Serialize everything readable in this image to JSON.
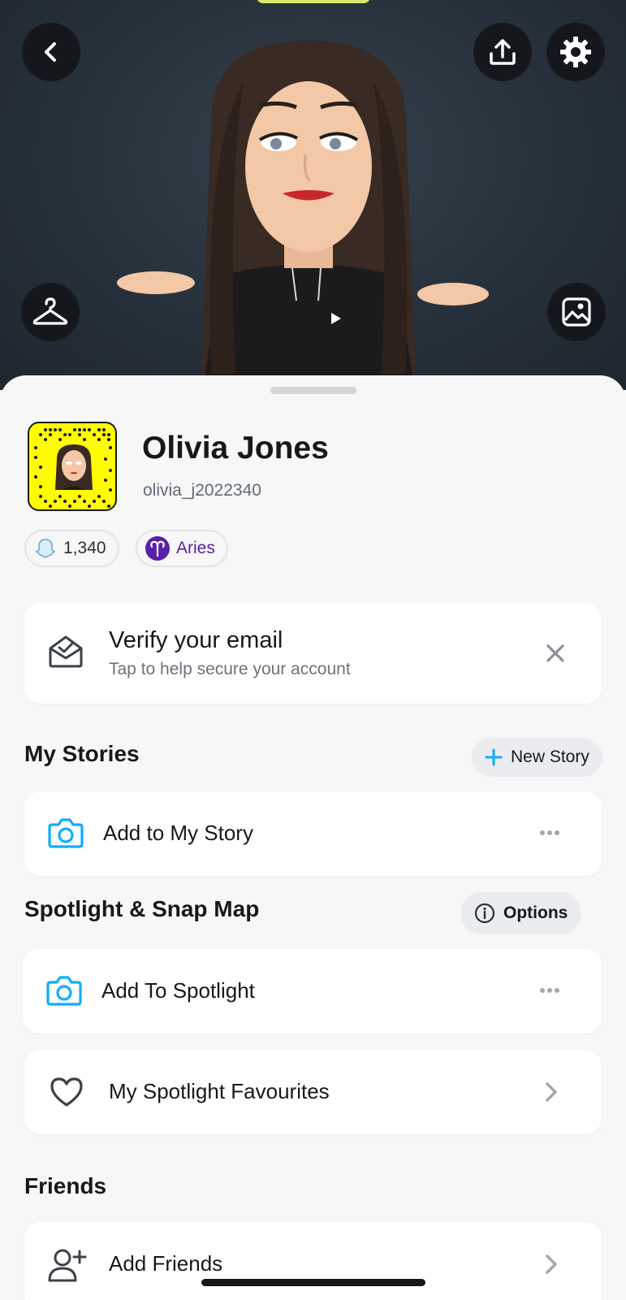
{
  "profile": {
    "display_name": "Olivia Jones",
    "username": "olivia_j2022340",
    "snap_score": "1,340",
    "zodiac": "Aries"
  },
  "header_buttons": {
    "back": "chevron-left-icon",
    "share": "upload-icon",
    "settings": "gear-icon",
    "outfit": "hanger-icon",
    "background": "image-icon"
  },
  "verify_card": {
    "title": "Verify your email",
    "subtitle": "Tap to help secure your account"
  },
  "my_stories": {
    "title": "My Stories",
    "new_story_label": "New Story",
    "add_story_label": "Add to My Story"
  },
  "spotlight": {
    "title": "Spotlight & Snap Map",
    "options_label": "Options",
    "add_spotlight_label": "Add To Spotlight",
    "favourites_label": "My Spotlight Favourites"
  },
  "friends": {
    "title": "Friends",
    "add_friends_label": "Add Friends"
  },
  "colors": {
    "accent_blue": "#0fadff",
    "snap_yellow": "#fffc00",
    "zodiac_purple": "#5a1fa8",
    "hero_bg": "#27313b"
  }
}
